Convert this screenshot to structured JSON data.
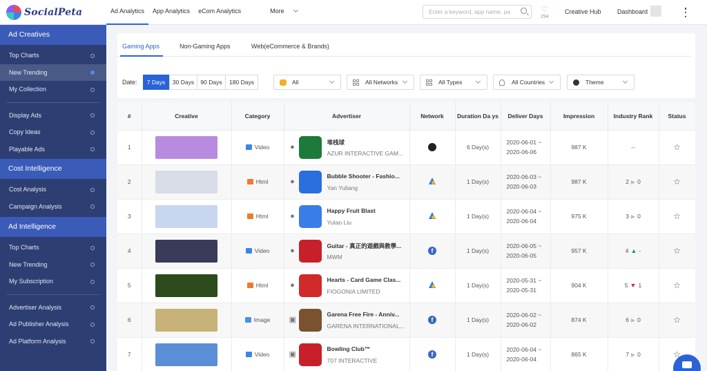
{
  "brand": {
    "name": "SocialPeta"
  },
  "topnav": {
    "items": [
      "Ad Analytics",
      "App Analytics",
      "eCom Analytics"
    ],
    "more": "More"
  },
  "search": {
    "placeholder": "Enter a keyword, app name, pa"
  },
  "favorites": {
    "count": "294"
  },
  "header_links": {
    "creative_hub": "Creative Hub",
    "dashboard": "Dashboard"
  },
  "sidebar": {
    "sections": [
      {
        "title": "Ad Creatives",
        "items": [
          {
            "label": "Top Charts"
          },
          {
            "label": "New Trending",
            "selected": true
          },
          {
            "label": "My Collection"
          }
        ]
      },
      {
        "title": "",
        "items": [
          {
            "label": "Display Ads"
          },
          {
            "label": "Copy Ideas"
          },
          {
            "label": "Playable Ads"
          }
        ]
      },
      {
        "title": "Cost Intelligence",
        "items": [
          {
            "label": "Cost Analysis"
          },
          {
            "label": "Campaign Analysis"
          }
        ]
      },
      {
        "title": "Ad Intelligence",
        "items": [
          {
            "label": "Top Charts"
          },
          {
            "label": "New Trending"
          },
          {
            "label": "My Subscription"
          }
        ]
      },
      {
        "title": "",
        "items": [
          {
            "label": "Advertiser Analysis"
          },
          {
            "label": "Ad Publisher Analysis"
          },
          {
            "label": "Ad Platform Analysis"
          }
        ]
      }
    ]
  },
  "tabs": {
    "items": [
      "Gaming Apps",
      "Non-Gaming Apps",
      "Web(eCommerce & Brands)"
    ],
    "active": 0
  },
  "filters": {
    "date_label": "Date:",
    "date_options": [
      "7 Days",
      "30 Days",
      "90 Days",
      "180 Days"
    ],
    "date_active": 0,
    "selects": {
      "category": "All",
      "network": "All Networks",
      "type": "All Types",
      "country": "All Countries",
      "theme": "Theme"
    }
  },
  "table": {
    "headers": {
      "num": "#",
      "creative": "Creative",
      "category": "Category",
      "advertiser": "Advertiser",
      "network": "Network",
      "duration": "Duration Da ys",
      "deliver": "Deliver Days",
      "impression": "Impression",
      "rank": "Industry Rank",
      "status": "Status"
    },
    "rows": [
      {
        "num": "1",
        "thumb_color": "#b98be0",
        "category": "Video",
        "os": "ios",
        "app_color": "#1e7a3a",
        "name": "堆栈球",
        "company": "AZUR INTERACTIVE GAM...",
        "network": "tiktok",
        "duration": "6 Day(s)",
        "start": "2020-06-01 ~",
        "end": "2020-06-06",
        "impression": "987 K",
        "rank": "--",
        "rank_dir": "none",
        "rank_change": ""
      },
      {
        "num": "2",
        "thumb_color": "#d8dce6",
        "category": "Html",
        "os": "ios",
        "app_color": "#2a6ee0",
        "name": "Bubble Shooter - Fashio...",
        "company": "Yan Yuliang",
        "network": "google",
        "duration": "1 Day(s)",
        "start": "2020-06-03 ~",
        "end": "2020-06-03",
        "impression": "987 K",
        "rank": "2",
        "rank_dir": "flat",
        "rank_change": "0"
      },
      {
        "num": "3",
        "thumb_color": "#c9d6ef",
        "category": "Html",
        "os": "ios",
        "app_color": "#3a7de8",
        "name": "Happy Fruit Blast",
        "company": "Yutao Liu",
        "network": "google",
        "duration": "1 Day(s)",
        "start": "2020-06-04 ~",
        "end": "2020-06-04",
        "impression": "975 K",
        "rank": "3",
        "rank_dir": "flat",
        "rank_change": "0"
      },
      {
        "num": "4",
        "thumb_color": "#3a3a5a",
        "category": "Video",
        "os": "ios",
        "app_color": "#c8202a",
        "name": "Guitar - 真正的遊戲與教學...",
        "company": "MWM",
        "network": "facebook",
        "duration": "1 Day(s)",
        "start": "2020-06-05 ~",
        "end": "2020-06-05",
        "impression": "957 K",
        "rank": "4",
        "rank_dir": "up",
        "rank_change": "-"
      },
      {
        "num": "5",
        "thumb_color": "#2c4a1c",
        "category": "Html",
        "os": "ios",
        "app_color": "#d02a2a",
        "name": "Hearts - Card Game Clas...",
        "company": "FIOGONIA LIMITED",
        "network": "google",
        "duration": "1 Day(s)",
        "start": "2020-05-31 ~",
        "end": "2020-05-31",
        "impression": "904 K",
        "rank": "5",
        "rank_dir": "down",
        "rank_change": "1"
      },
      {
        "num": "6",
        "thumb_color": "#c7b27a",
        "category": "Image",
        "os": "android",
        "app_color": "#7a5230",
        "name": "Garena Free Fire - Anniv...",
        "company": "GARENA INTERNATIONAL...",
        "network": "facebook",
        "duration": "1 Day(s)",
        "start": "2020-06-02 ~",
        "end": "2020-06-02",
        "impression": "874 K",
        "rank": "6",
        "rank_dir": "flat",
        "rank_change": "0"
      },
      {
        "num": "7",
        "thumb_color": "#5a8fd8",
        "category": "Video",
        "os": "android",
        "app_color": "#c8202a",
        "name": "Bowling Club™",
        "company": "707 INTERACTIVE",
        "network": "facebook",
        "duration": "1 Day(s)",
        "start": "2020-06-04 ~",
        "end": "2020-06-04",
        "impression": "865 K",
        "rank": "7",
        "rank_dir": "flat",
        "rank_change": "0"
      }
    ]
  },
  "colors": {
    "primary": "#2a62d8",
    "sidebar": "#2d3e72",
    "sidebar_header": "#3b5bb8",
    "up": "#1aa34a",
    "down": "#dd2222"
  }
}
